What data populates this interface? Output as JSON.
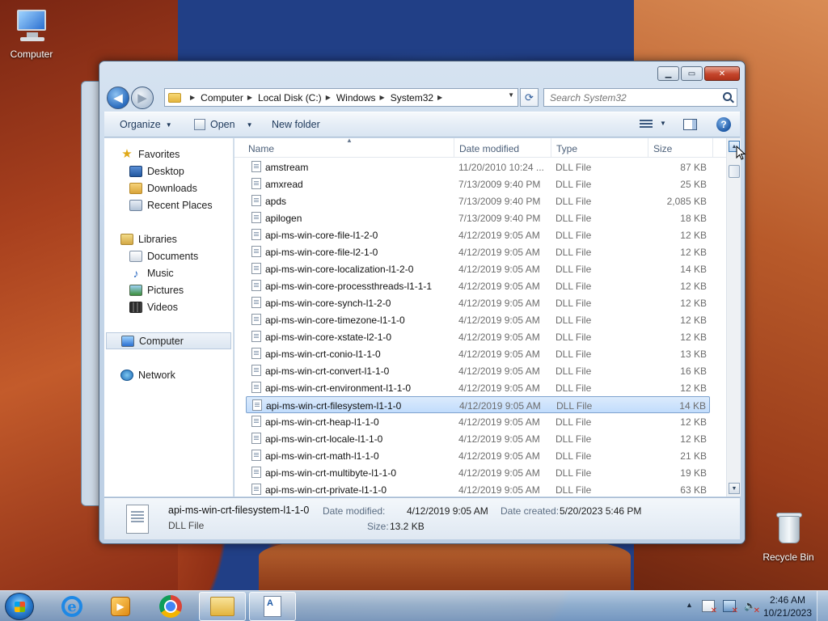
{
  "desktop": {
    "icons": [
      {
        "label": "Computer",
        "icon": "computer-icon"
      },
      {
        "label": "Recycle Bin",
        "icon": "recycle-bin-icon"
      }
    ]
  },
  "window": {
    "caption_buttons": {
      "minimize": "▁",
      "maximize": "▭",
      "close": "✕"
    },
    "nav": {
      "back": "◀",
      "forward": "▶"
    },
    "address": {
      "crumbs": [
        "Computer",
        "Local Disk (C:)",
        "Windows",
        "System32"
      ]
    },
    "search": {
      "placeholder": "Search System32"
    },
    "toolbar": {
      "organize": "Organize",
      "open": "Open",
      "new_folder": "New folder"
    },
    "nav_pane": {
      "favorites": "Favorites",
      "desktop": "Desktop",
      "downloads": "Downloads",
      "recent_places": "Recent Places",
      "libraries": "Libraries",
      "documents": "Documents",
      "music": "Music",
      "pictures": "Pictures",
      "videos": "Videos",
      "computer": "Computer",
      "network": "Network"
    },
    "columns": {
      "name": "Name",
      "date_modified": "Date modified",
      "type": "Type",
      "size": "Size"
    },
    "files": [
      {
        "name": "amstream",
        "date": "11/20/2010 10:24 ...",
        "type": "DLL File",
        "size": "87 KB"
      },
      {
        "name": "amxread",
        "date": "7/13/2009 9:40 PM",
        "type": "DLL File",
        "size": "25 KB"
      },
      {
        "name": "apds",
        "date": "7/13/2009 9:40 PM",
        "type": "DLL File",
        "size": "2,085 KB"
      },
      {
        "name": "apilogen",
        "date": "7/13/2009 9:40 PM",
        "type": "DLL File",
        "size": "18 KB"
      },
      {
        "name": "api-ms-win-core-file-l1-2-0",
        "date": "4/12/2019 9:05 AM",
        "type": "DLL File",
        "size": "12 KB"
      },
      {
        "name": "api-ms-win-core-file-l2-1-0",
        "date": "4/12/2019 9:05 AM",
        "type": "DLL File",
        "size": "12 KB"
      },
      {
        "name": "api-ms-win-core-localization-l1-2-0",
        "date": "4/12/2019 9:05 AM",
        "type": "DLL File",
        "size": "14 KB"
      },
      {
        "name": "api-ms-win-core-processthreads-l1-1-1",
        "date": "4/12/2019 9:05 AM",
        "type": "DLL File",
        "size": "12 KB"
      },
      {
        "name": "api-ms-win-core-synch-l1-2-0",
        "date": "4/12/2019 9:05 AM",
        "type": "DLL File",
        "size": "12 KB"
      },
      {
        "name": "api-ms-win-core-timezone-l1-1-0",
        "date": "4/12/2019 9:05 AM",
        "type": "DLL File",
        "size": "12 KB"
      },
      {
        "name": "api-ms-win-core-xstate-l2-1-0",
        "date": "4/12/2019 9:05 AM",
        "type": "DLL File",
        "size": "12 KB"
      },
      {
        "name": "api-ms-win-crt-conio-l1-1-0",
        "date": "4/12/2019 9:05 AM",
        "type": "DLL File",
        "size": "13 KB"
      },
      {
        "name": "api-ms-win-crt-convert-l1-1-0",
        "date": "4/12/2019 9:05 AM",
        "type": "DLL File",
        "size": "16 KB"
      },
      {
        "name": "api-ms-win-crt-environment-l1-1-0",
        "date": "4/12/2019 9:05 AM",
        "type": "DLL File",
        "size": "12 KB"
      },
      {
        "name": "api-ms-win-crt-filesystem-l1-1-0",
        "date": "4/12/2019 9:05 AM",
        "type": "DLL File",
        "size": "14 KB",
        "selected": true
      },
      {
        "name": "api-ms-win-crt-heap-l1-1-0",
        "date": "4/12/2019 9:05 AM",
        "type": "DLL File",
        "size": "12 KB"
      },
      {
        "name": "api-ms-win-crt-locale-l1-1-0",
        "date": "4/12/2019 9:05 AM",
        "type": "DLL File",
        "size": "12 KB"
      },
      {
        "name": "api-ms-win-crt-math-l1-1-0",
        "date": "4/12/2019 9:05 AM",
        "type": "DLL File",
        "size": "21 KB"
      },
      {
        "name": "api-ms-win-crt-multibyte-l1-1-0",
        "date": "4/12/2019 9:05 AM",
        "type": "DLL File",
        "size": "19 KB"
      },
      {
        "name": "api-ms-win-crt-private-l1-1-0",
        "date": "4/12/2019 9:05 AM",
        "type": "DLL File",
        "size": "63 KB"
      }
    ],
    "details": {
      "name": "api-ms-win-crt-filesystem-l1-1-0",
      "kind": "DLL File",
      "date_modified_label": "Date modified:",
      "date_modified": "4/12/2019 9:05 AM",
      "date_created_label": "Date created:",
      "date_created": "5/20/2023 5:46 PM",
      "size_label": "Size:",
      "size": "13.2 KB"
    }
  },
  "taskbar": {
    "apps": [
      "internet-explorer-icon",
      "media-player-icon",
      "chrome-icon",
      "windows-explorer-icon",
      "document-icon"
    ],
    "clock": {
      "time": "2:46 AM",
      "date": "10/21/2023"
    }
  }
}
